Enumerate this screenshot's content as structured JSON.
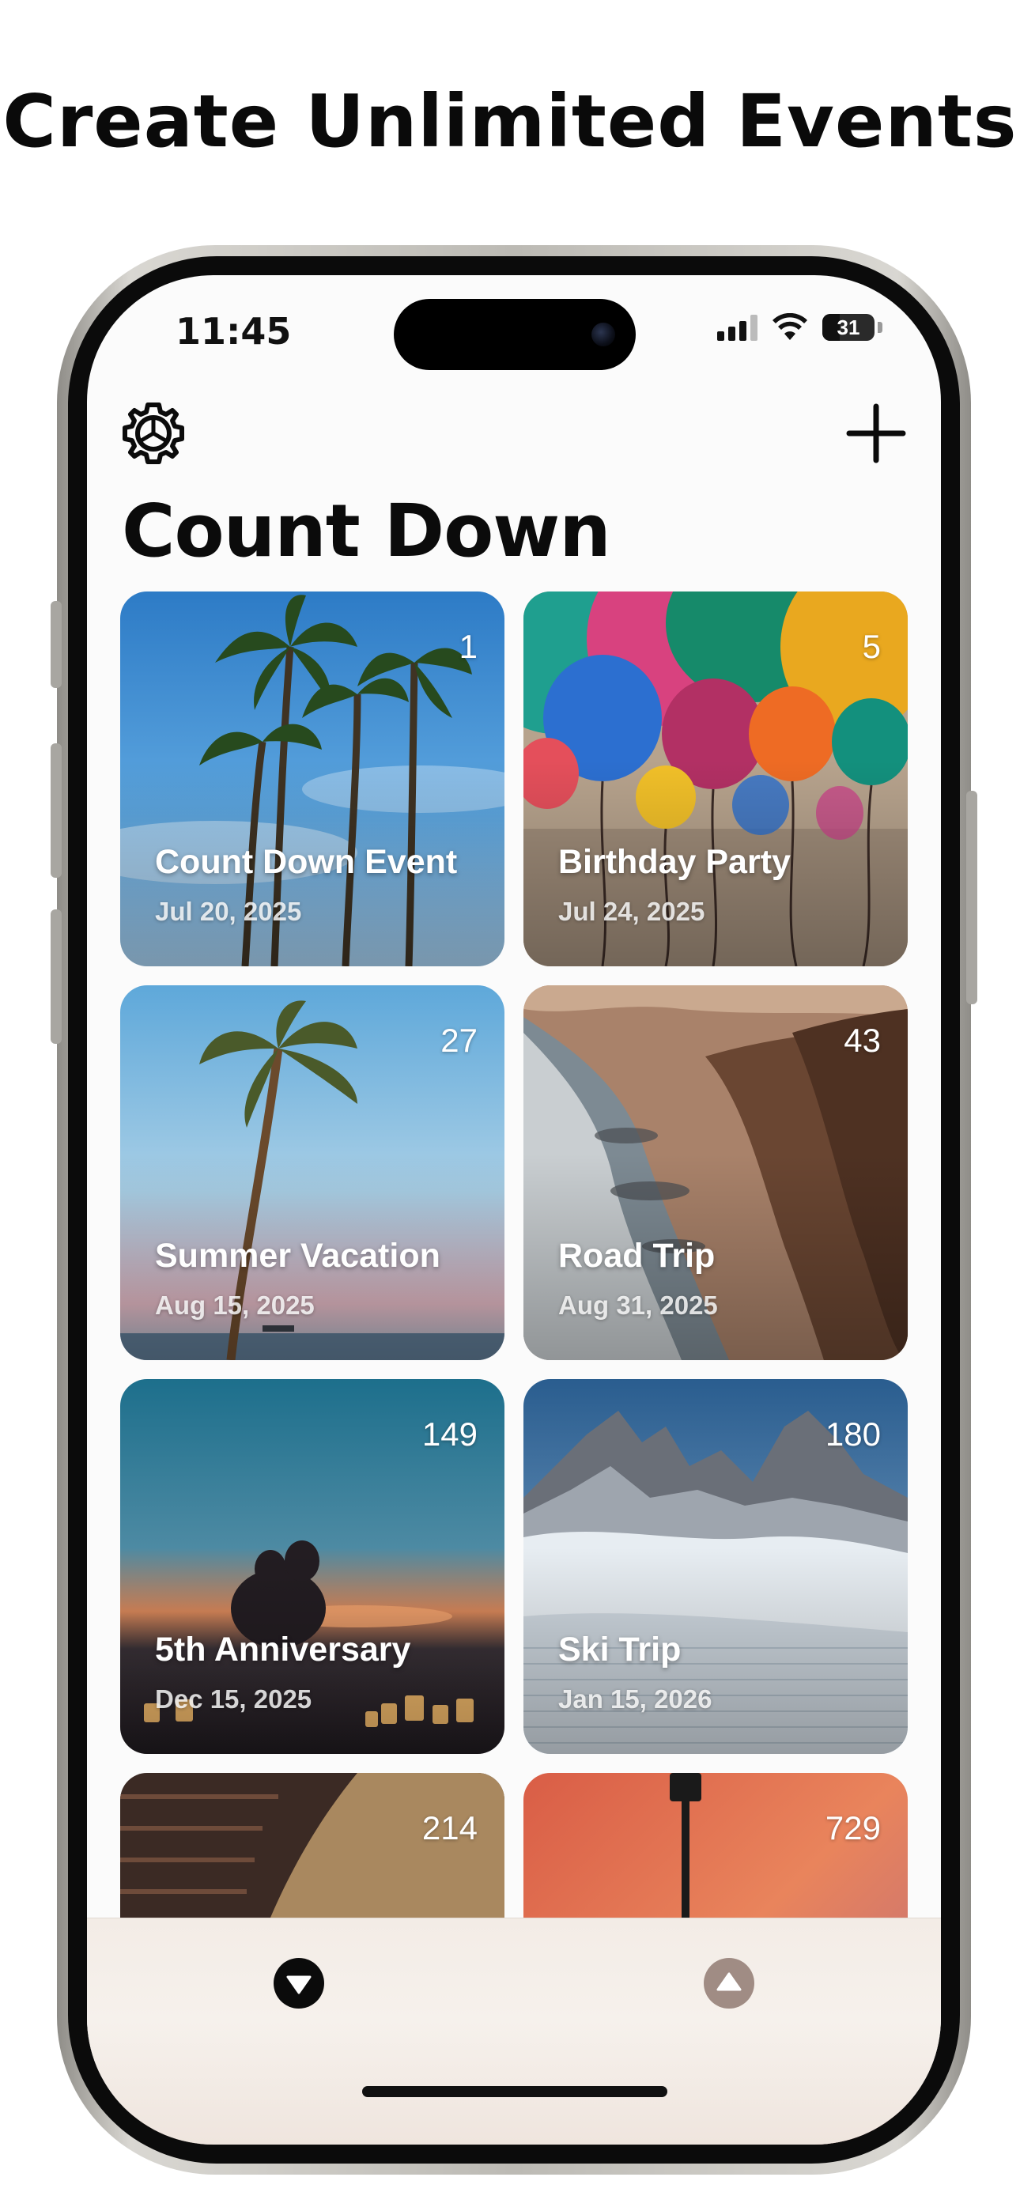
{
  "promo": {
    "headline": "Create Unlimited Events"
  },
  "status_bar": {
    "time": "11:45",
    "battery": "31"
  },
  "header": {
    "title": "Count Down",
    "settings_icon": "gear-icon",
    "add_icon": "plus-icon"
  },
  "events": [
    {
      "name": "Count Down Event",
      "date": "Jul 20, 2025",
      "days": "1",
      "scene": "palm-trees-sky"
    },
    {
      "name": "Birthday Party",
      "date": "Jul 24, 2025",
      "days": "5",
      "scene": "balloons"
    },
    {
      "name": "Summer Vacation",
      "date": "Aug 15, 2025",
      "days": "27",
      "scene": "palm-beach-dusk"
    },
    {
      "name": "Road Trip",
      "date": "Aug 31, 2025",
      "days": "43",
      "scene": "coastal-cliffs"
    },
    {
      "name": "5th Anniversary",
      "date": "Dec 15, 2025",
      "days": "149",
      "scene": "couple-sunset-candles"
    },
    {
      "name": "Ski Trip",
      "date": "Jan 15, 2026",
      "days": "180",
      "scene": "snowy-mountains"
    },
    {
      "name": "",
      "date": "",
      "days": "214",
      "scene": "stone-arches"
    },
    {
      "name": "",
      "date": "",
      "days": "729",
      "scene": "sunset-lamp-post"
    }
  ],
  "tab_bar": {
    "sort_descending_icon": "arrow-down-circle-icon",
    "sort_ascending_icon": "arrow-up-circle-icon"
  }
}
